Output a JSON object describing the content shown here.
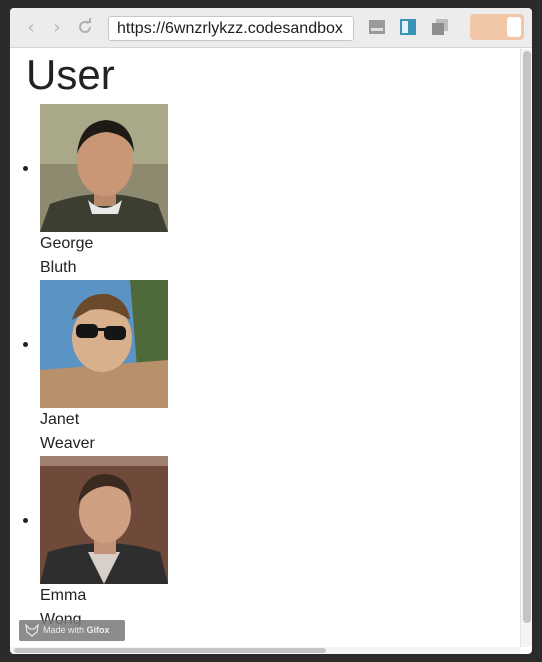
{
  "browser": {
    "url": "https://6wnzrlykzz.codesandbox",
    "back_icon": "chevron-left-icon",
    "forward_icon": "chevron-right-icon",
    "reload_icon": "reload-icon"
  },
  "page": {
    "title": "User",
    "users": [
      {
        "first_name": "George",
        "last_name": "Bluth",
        "avatar": "avatar-photo"
      },
      {
        "first_name": "Janet",
        "last_name": "Weaver",
        "avatar": "avatar-photo"
      },
      {
        "first_name": "Emma",
        "last_name": "Wong",
        "avatar": "avatar-photo"
      }
    ]
  },
  "watermark": {
    "prefix": "Made with ",
    "brand": "Gifox"
  },
  "colors": {
    "accent": "#f2c7a8",
    "window_bg": "#ececec"
  }
}
